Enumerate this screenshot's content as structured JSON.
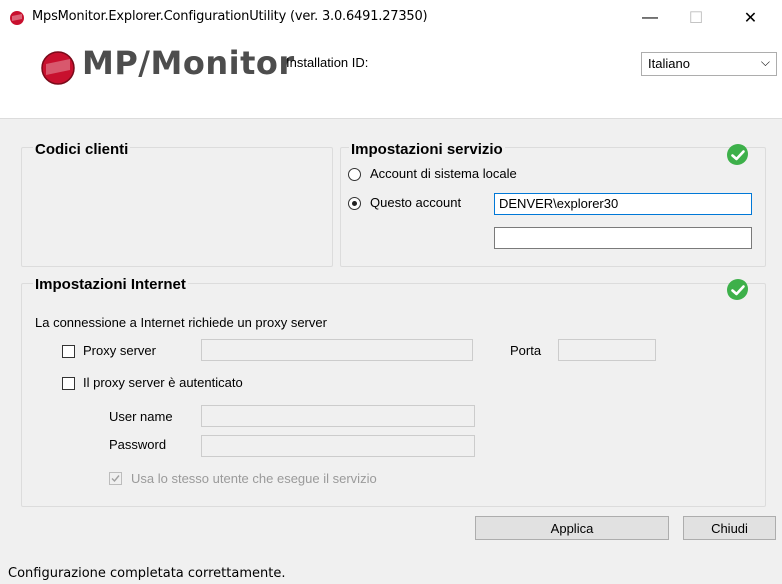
{
  "window": {
    "title": "MpsMonitor.Explorer.ConfigurationUtility (ver. 3.0.6491.27350)",
    "minimize_glyph": "—",
    "maximize_glyph": "☐",
    "close_glyph": "✕"
  },
  "header": {
    "logo_text": "MP/Monitor",
    "installation_id_label": "Installation ID:",
    "language_value": "Italiano"
  },
  "codici_clienti": {
    "title": "Codici clienti"
  },
  "impostazioni_servizio": {
    "title": "Impostazioni servizio",
    "radio_local_label": "Account di sistema locale",
    "radio_account_label": "Questo account",
    "account_value": "DENVER\\explorer30",
    "password_value": ""
  },
  "impostazioni_internet": {
    "title": "Impostazioni Internet",
    "proxy_required_text": "La connessione a Internet richiede un proxy server",
    "proxy_server_label": "Proxy server",
    "porta_label": "Porta",
    "proxy_auth_label": "Il proxy server è autenticato",
    "username_label": "User name",
    "password_label": "Password",
    "same_user_label": "Usa lo stesso utente che esegue il servizio"
  },
  "buttons": {
    "apply": "Applica",
    "close": "Chiudi"
  },
  "status_bar": {
    "text": "Configurazione completata correttamente."
  },
  "colors": {
    "ok_green": "#3db04a",
    "logo_red": "#c8102e"
  }
}
